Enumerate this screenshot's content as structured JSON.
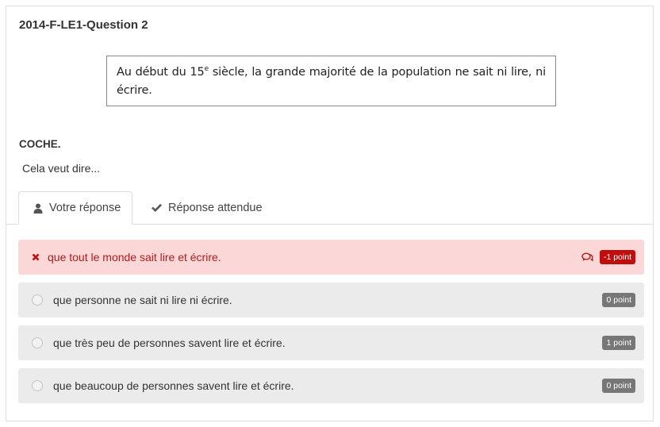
{
  "question": {
    "title": "2014-F-LE1-Question 2",
    "quote_part1": "Au début du 15",
    "quote_sup": "e",
    "quote_part2": " siècle, la grande majorité de la population ne sait ni lire, ni écrire.",
    "instruction": "COCHE.",
    "prompt": "Cela veut dire..."
  },
  "tabs": [
    {
      "label": "Votre réponse",
      "icon": "user-icon"
    },
    {
      "label": "Réponse attendue",
      "icon": "check-icon"
    }
  ],
  "options": [
    {
      "text": "que tout le monde sait lire et écrire.",
      "points": "-1 point",
      "state": "wrong"
    },
    {
      "text": "que personne ne sait ni lire ni écrire.",
      "points": "0 point",
      "state": "neutral"
    },
    {
      "text": "que très peu de personnes savent lire et écrire.",
      "points": "1 point",
      "state": "neutral"
    },
    {
      "text": "que beaucoup de personnes savent lire et écrire.",
      "points": "0 point",
      "state": "neutral"
    }
  ],
  "colors": {
    "wrong_bg": "#fcd7d7",
    "wrong_text": "#b11b1b",
    "wrong_badge": "#c00d0d",
    "neutral_bg": "#ebebeb",
    "neutral_badge": "#777777"
  }
}
